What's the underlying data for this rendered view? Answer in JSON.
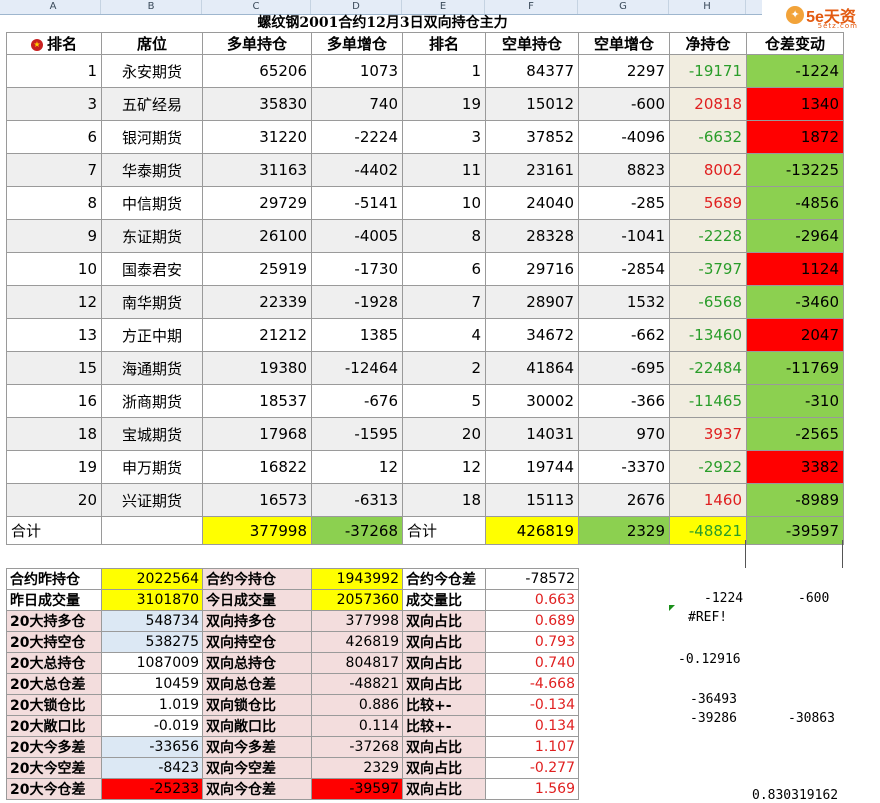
{
  "col_letters": [
    "A",
    "B",
    "C",
    "D",
    "E",
    "F",
    "G",
    "H",
    "I"
  ],
  "logo": {
    "text": "5e天资",
    "sub": "5etz.com"
  },
  "title": "螺纹钢2001合约12月3日双向持仓主力",
  "headers": [
    "排名",
    "席位",
    "多单持仓",
    "多单增仓",
    "排名",
    "空单持仓",
    "空单增仓",
    "净持仓",
    "仓差变动"
  ],
  "rows": [
    {
      "rank": "1",
      "name": "永安期货",
      "long": "65206",
      "long_chg": "1073",
      "srank": "1",
      "short": "84377",
      "short_chg": "2297",
      "net": "-19171",
      "diff": "-1224"
    },
    {
      "rank": "3",
      "name": "五矿经易",
      "long": "35830",
      "long_chg": "740",
      "srank": "19",
      "short": "15012",
      "short_chg": "-600",
      "net": "20818",
      "diff": "1340"
    },
    {
      "rank": "6",
      "name": "银河期货",
      "long": "31220",
      "long_chg": "-2224",
      "srank": "3",
      "short": "37852",
      "short_chg": "-4096",
      "net": "-6632",
      "diff": "1872"
    },
    {
      "rank": "7",
      "name": "华泰期货",
      "long": "31163",
      "long_chg": "-4402",
      "srank": "11",
      "short": "23161",
      "short_chg": "8823",
      "net": "8002",
      "diff": "-13225"
    },
    {
      "rank": "8",
      "name": "中信期货",
      "long": "29729",
      "long_chg": "-5141",
      "srank": "10",
      "short": "24040",
      "short_chg": "-285",
      "net": "5689",
      "diff": "-4856"
    },
    {
      "rank": "9",
      "name": "东证期货",
      "long": "26100",
      "long_chg": "-4005",
      "srank": "8",
      "short": "28328",
      "short_chg": "-1041",
      "net": "-2228",
      "diff": "-2964"
    },
    {
      "rank": "10",
      "name": "国泰君安",
      "long": "25919",
      "long_chg": "-1730",
      "srank": "6",
      "short": "29716",
      "short_chg": "-2854",
      "net": "-3797",
      "diff": "1124"
    },
    {
      "rank": "12",
      "name": "南华期货",
      "long": "22339",
      "long_chg": "-1928",
      "srank": "7",
      "short": "28907",
      "short_chg": "1532",
      "net": "-6568",
      "diff": "-3460"
    },
    {
      "rank": "13",
      "name": "方正中期",
      "long": "21212",
      "long_chg": "1385",
      "srank": "4",
      "short": "34672",
      "short_chg": "-662",
      "net": "-13460",
      "diff": "2047"
    },
    {
      "rank": "15",
      "name": "海通期货",
      "long": "19380",
      "long_chg": "-12464",
      "srank": "2",
      "short": "41864",
      "short_chg": "-695",
      "net": "-22484",
      "diff": "-11769"
    },
    {
      "rank": "16",
      "name": "浙商期货",
      "long": "18537",
      "long_chg": "-676",
      "srank": "5",
      "short": "30002",
      "short_chg": "-366",
      "net": "-11465",
      "diff": "-310"
    },
    {
      "rank": "18",
      "name": "宝城期货",
      "long": "17968",
      "long_chg": "-1595",
      "srank": "20",
      "short": "14031",
      "short_chg": "970",
      "net": "3937",
      "diff": "-2565"
    },
    {
      "rank": "19",
      "name": "申万期货",
      "long": "16822",
      "long_chg": "12",
      "srank": "12",
      "short": "19744",
      "short_chg": "-3370",
      "net": "-2922",
      "diff": "3382"
    },
    {
      "rank": "20",
      "name": "兴证期货",
      "long": "16573",
      "long_chg": "-6313",
      "srank": "18",
      "short": "15113",
      "short_chg": "2676",
      "net": "1460",
      "diff": "-8989"
    }
  ],
  "total": {
    "label": "合计",
    "long": "377998",
    "long_chg": "-37268",
    "label2": "合计",
    "short": "426819",
    "short_chg": "2329",
    "net": "-48821",
    "diff": "-39597"
  },
  "stats": [
    [
      "合约昨持仓",
      "2022564",
      "合约今持仓",
      "1943992",
      "合约今仓差",
      "-78572"
    ],
    [
      "昨日成交量",
      "3101870",
      "今日成交量",
      "2057360",
      "成交量比",
      "0.663"
    ],
    [
      "20大持多仓",
      "548734",
      "双向持多仓",
      "377998",
      "双向占比",
      "0.689"
    ],
    [
      "20大持空仓",
      "538275",
      "双向持空仓",
      "426819",
      "双向占比",
      "0.793"
    ],
    [
      "20大总持仓",
      "1087009",
      "双向总持仓",
      "804817",
      "双向占比",
      "0.740"
    ],
    [
      "20大总仓差",
      "10459",
      "双向总仓差",
      "-48821",
      "双向占比",
      "-4.668"
    ],
    [
      "20大锁仓比",
      "1.019",
      "双向锁仓比",
      "0.886",
      "比较+-",
      "-0.134"
    ],
    [
      "20大敞口比",
      "-0.019",
      "双向敞口比",
      "0.114",
      "比较+-",
      "0.134"
    ],
    [
      "20大今多差",
      "-33656",
      "双向今多差",
      "-37268",
      "双向占比",
      "1.107"
    ],
    [
      "20大今空差",
      "-8423",
      "双向今空差",
      "2329",
      "双向占比",
      "-0.277"
    ],
    [
      "20大今仓差",
      "-25233",
      "双向今仓差",
      "-39597",
      "双向占比",
      "1.569"
    ]
  ],
  "stray": {
    "h1": "-1224",
    "i1": "-600",
    "ref": "#REF!",
    "h2": "-0.12916",
    "h3": "-36493",
    "h4": "-39286",
    "i4": "-30863",
    "bottom": "0.830319162"
  }
}
